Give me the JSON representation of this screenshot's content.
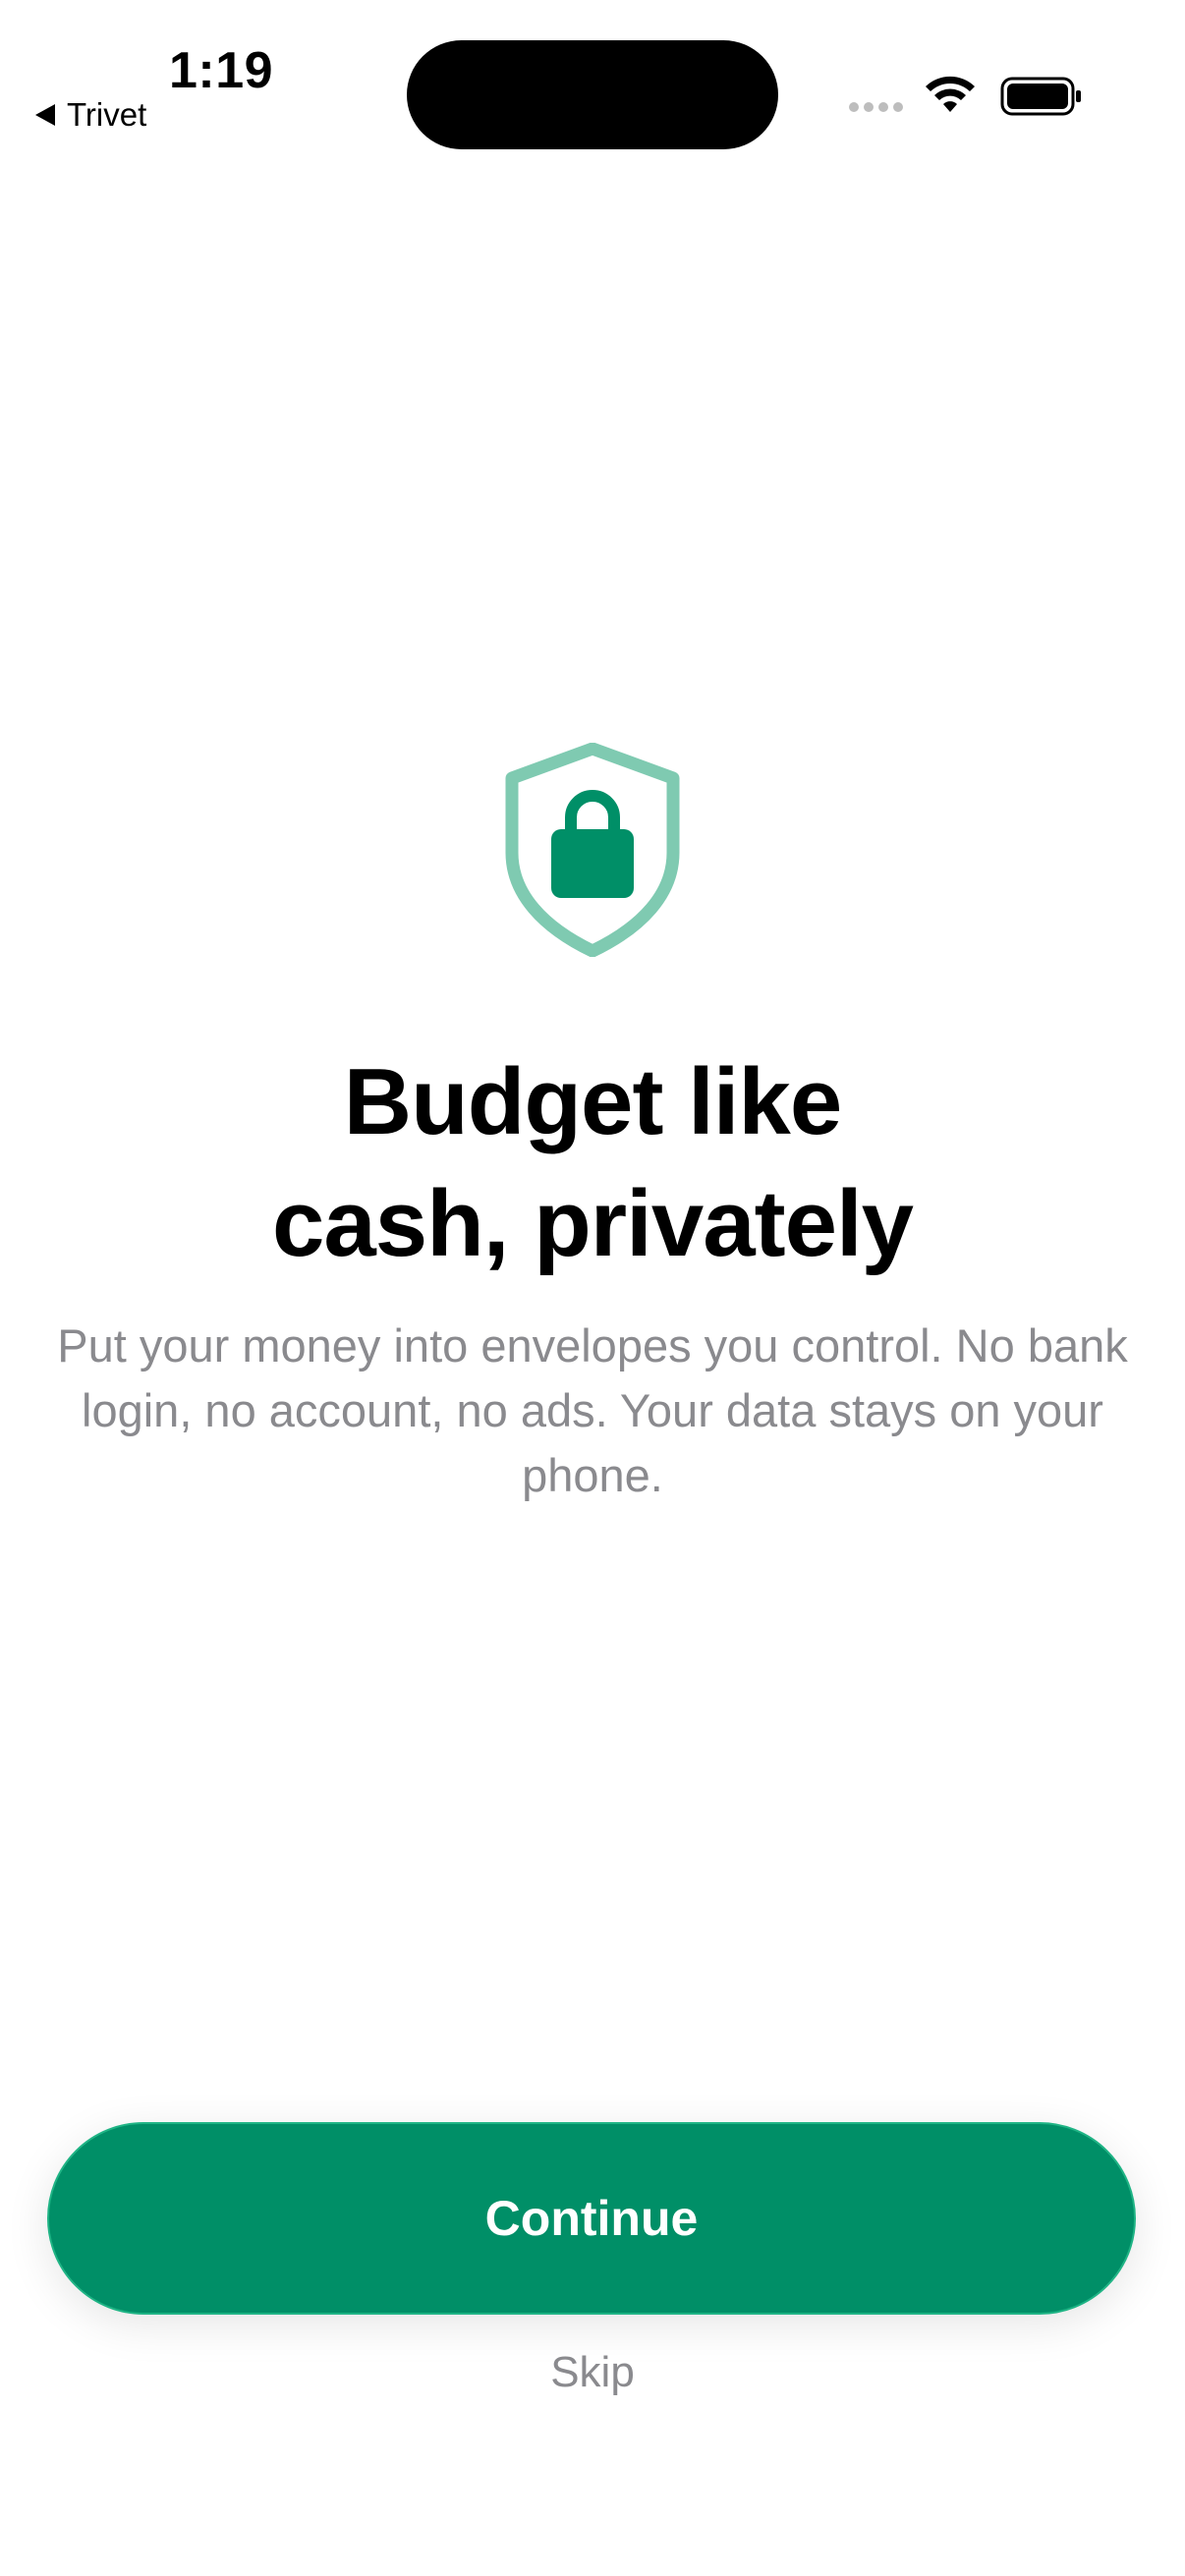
{
  "status_bar": {
    "time": "1:19",
    "back_app": "Trivet"
  },
  "onboarding": {
    "icon": "lock-shield-icon",
    "title_line1": "Budget like",
    "title_line2": "cash, privately",
    "body": "Put your money into envelopes you control. No bank login, no account, no ads. Your data stays on your phone."
  },
  "actions": {
    "continue_label": "Continue",
    "skip_label": "Skip"
  },
  "colors": {
    "accent": "#008f67",
    "shield_outline": "#7fcab1",
    "secondary_text": "#8a8a8e"
  }
}
